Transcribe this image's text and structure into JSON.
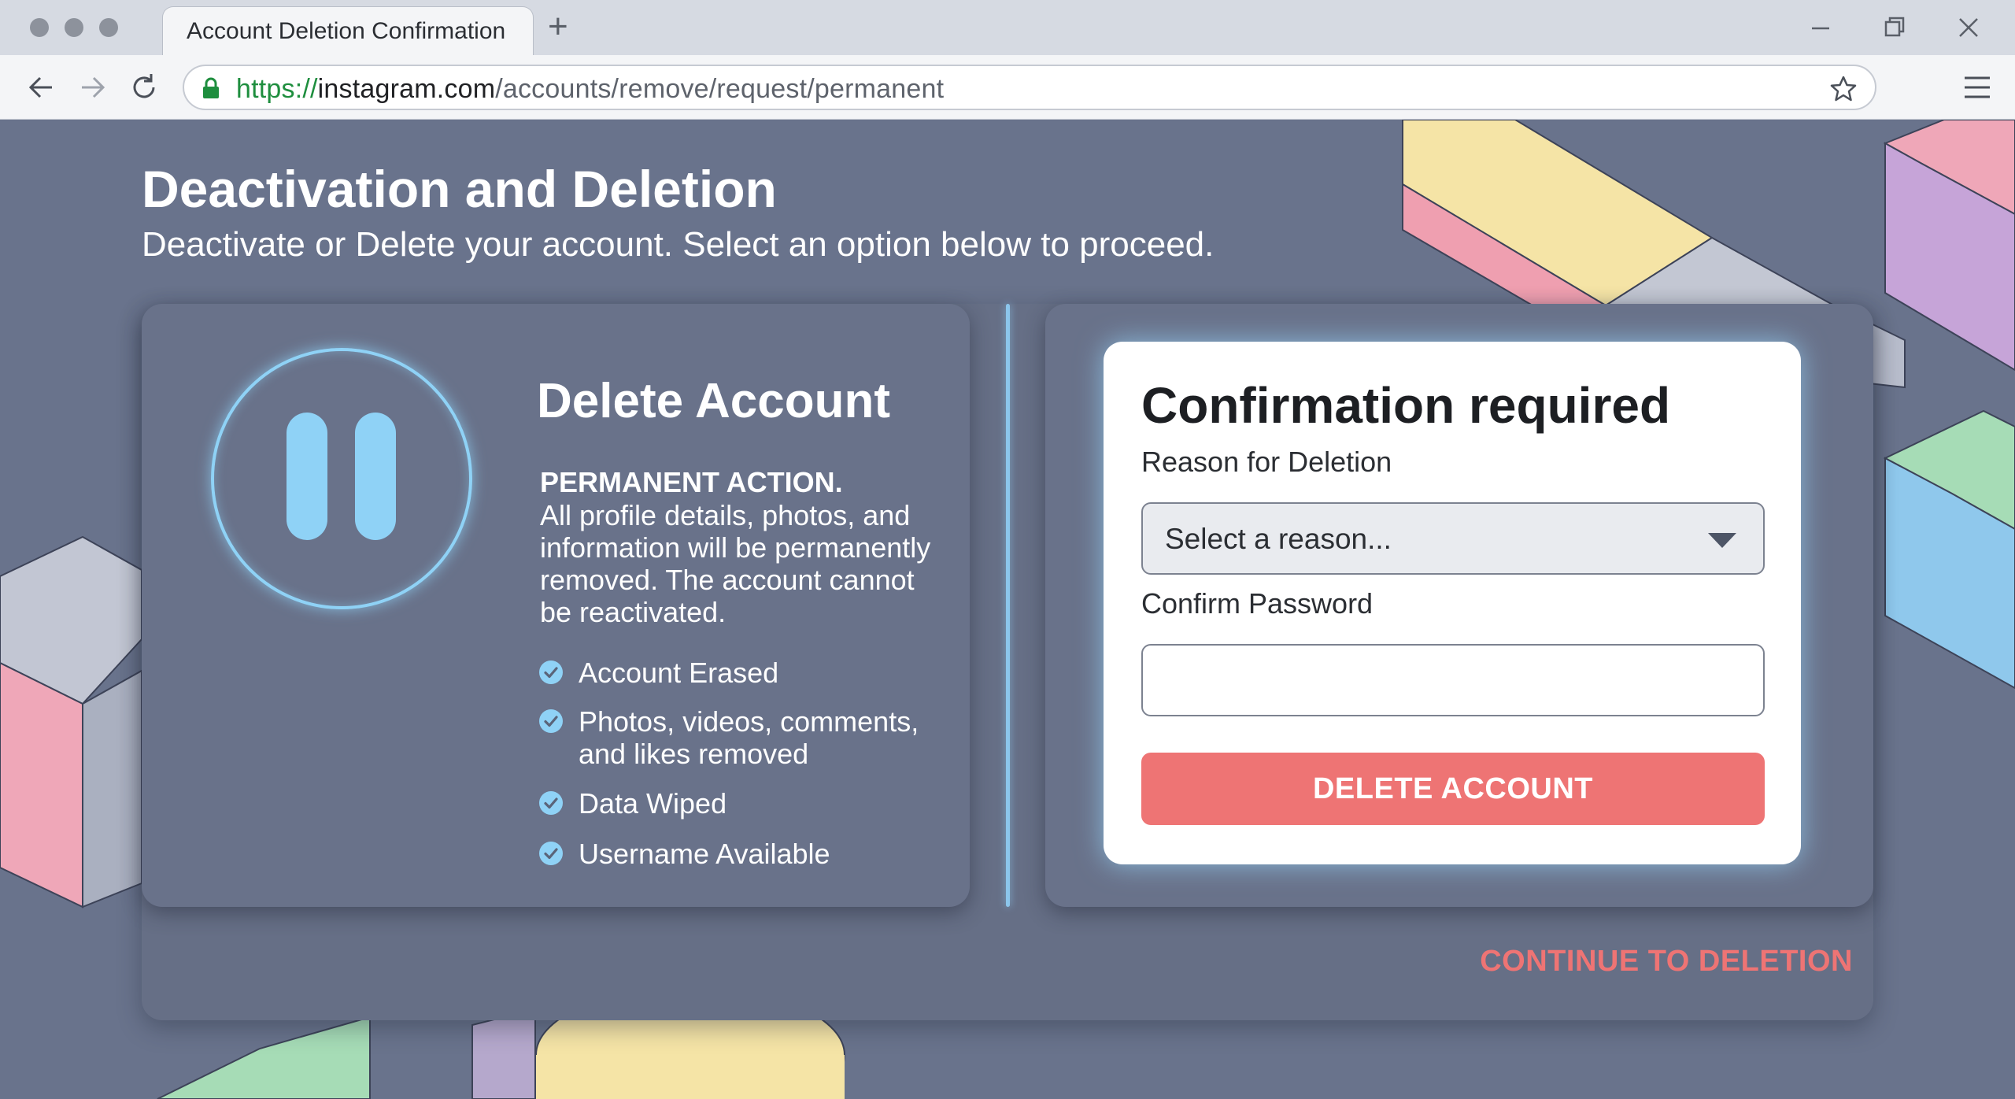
{
  "browser": {
    "tab_title": "Account Deletion Confirmation",
    "url": {
      "scheme": "https://",
      "host": "instagram.com",
      "path": "/accounts/remove/request/permanent"
    }
  },
  "header": {
    "title": "Deactivation and Deletion",
    "subtitle": "Deactivate or Delete your account. Select an option below to proceed."
  },
  "delete_card": {
    "title": "Delete Account",
    "warning_heading": "PERMANENT ACTION.",
    "warning_body": "All profile details, photos, and information will be permanently removed. The account cannot be reactivated.",
    "checklist": [
      "Account Erased",
      "Photos, videos, comments, and likes removed",
      "Data Wiped",
      "Username Available"
    ]
  },
  "confirmation": {
    "title": "Confirmation required",
    "reason_label": "Reason for Deletion",
    "reason_value": "Select a reason...",
    "password_label": "Confirm Password",
    "password_value": "",
    "delete_button": "DELETE ACCOUNT"
  },
  "footer": {
    "continue_link": "CONTINUE TO DELETION"
  },
  "colors": {
    "background": "#69738c",
    "accent_blue": "#8fd2f6",
    "danger": "#ee7474",
    "url_secure": "#1e8e3e"
  },
  "icons": [
    "back-icon",
    "forward-icon",
    "reload-icon",
    "lock-icon",
    "star-icon",
    "menu-icon",
    "pause-icon",
    "check-circle-icon",
    "chevron-down-icon"
  ]
}
